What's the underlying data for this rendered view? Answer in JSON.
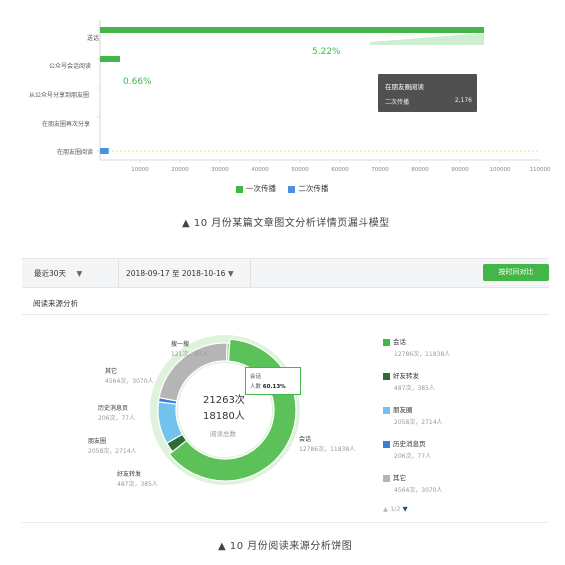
{
  "funnel": {
    "rows": [
      "送话",
      "公众号会话阅读",
      "从公众号分享到朋友圈",
      "在朋友圈再次分享",
      "在朋友圈阅读"
    ],
    "x_ticks": [
      "10000",
      "20000",
      "30000",
      "40000",
      "50000",
      "60000",
      "70000",
      "80000",
      "90000",
      "100000",
      "110000"
    ],
    "pct1": "5.22%",
    "pct2": "0.66%",
    "tooltip_title": "在朋友圈阅读",
    "tooltip_label": "二次传播",
    "tooltip_value": "2,176",
    "legend": [
      {
        "label": "一次传播",
        "color": "#44b549"
      },
      {
        "label": "二次传播",
        "color": "#4a90e2"
      }
    ],
    "caption": "▲ 10 月份某篇文章图文分析详情页漏斗模型"
  },
  "chart_data": [
    {
      "type": "bar",
      "orientation": "horizontal",
      "categories": [
        "送话",
        "公众号会话阅读",
        "从公众号分享到朋友圈",
        "在朋友圈再次分享",
        "在朋友圈阅读"
      ],
      "series": [
        {
          "name": "一次传播",
          "values": [
            96000,
            5000,
            0,
            0,
            0
          ]
        },
        {
          "name": "二次传播",
          "values": [
            0,
            0,
            0,
            0,
            2176
          ]
        }
      ],
      "xlim": [
        0,
        110000
      ]
    },
    {
      "type": "pie",
      "labels": [
        "会话",
        "好友转发",
        "朋友圈",
        "历史消息页",
        "其它",
        "搜一搜"
      ],
      "values": [
        12786,
        487,
        2058,
        206,
        4564,
        121
      ],
      "colors": [
        "#5dc15a",
        "#2e6b34",
        "#71c2ec",
        "#3b7dd8",
        "#b5b5b5",
        "#8fd883"
      ]
    }
  ],
  "toolbar": {
    "period": "最近30天",
    "date_range": "2018-09-17 至 2018-10-16",
    "compare_button": "按时间对比",
    "dropdown_glyph": "▼"
  },
  "source": {
    "section_title": "阅读来源分析",
    "center_count": "21263次",
    "center_people": "18180人",
    "center_label": "阅读总数",
    "tooltip_name": "会话",
    "tooltip_line": "人数",
    "tooltip_pct": "60.13%",
    "labels": [
      {
        "name": "搜一搜",
        "sub": "121次，97人"
      },
      {
        "name": "其它",
        "sub": "4564次，3070人"
      },
      {
        "name": "历史消息页",
        "sub": "206次，77人"
      },
      {
        "name": "朋友圈",
        "sub": "2058次，2714人"
      },
      {
        "name": "好友转发",
        "sub": "487次，385人"
      },
      {
        "name": "会话",
        "sub": "12786次，11838人"
      }
    ],
    "legend": [
      {
        "name": "会话",
        "sub": "12786次，11838人",
        "color": "#44b549"
      },
      {
        "name": "好友转发",
        "sub": "487次，385人",
        "color": "#2e6b34"
      },
      {
        "name": "朋友圈",
        "sub": "2058次，2714人",
        "color": "#71c2ec"
      },
      {
        "name": "历史消息页",
        "sub": "206次，77人",
        "color": "#3b7dd8"
      },
      {
        "name": "其它",
        "sub": "4564次，3070人",
        "color": "#b5b5b5"
      }
    ],
    "pager": "1/2",
    "caption": "▲ 10 月份阅读来源分析饼图"
  }
}
